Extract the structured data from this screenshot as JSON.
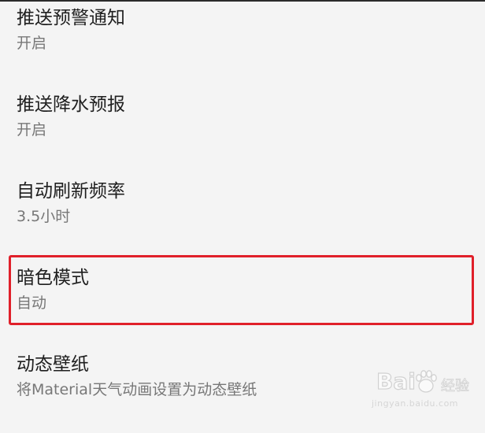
{
  "settings": [
    {
      "title": "推送预警通知",
      "summary": "开启"
    },
    {
      "title": "推送降水预报",
      "summary": "开启"
    },
    {
      "title": "自动刷新频率",
      "summary": "3.5小时"
    },
    {
      "title": "暗色模式",
      "summary": "自动"
    },
    {
      "title": "动态壁纸",
      "summary": "将Material天气动画设置为动态壁纸"
    }
  ],
  "highlight": {
    "color": "#e0202a",
    "target": "暗色模式"
  },
  "watermark": {
    "brand": "Bai",
    "brand_suffix": "经验",
    "url": "jingyan.baidu.com"
  }
}
